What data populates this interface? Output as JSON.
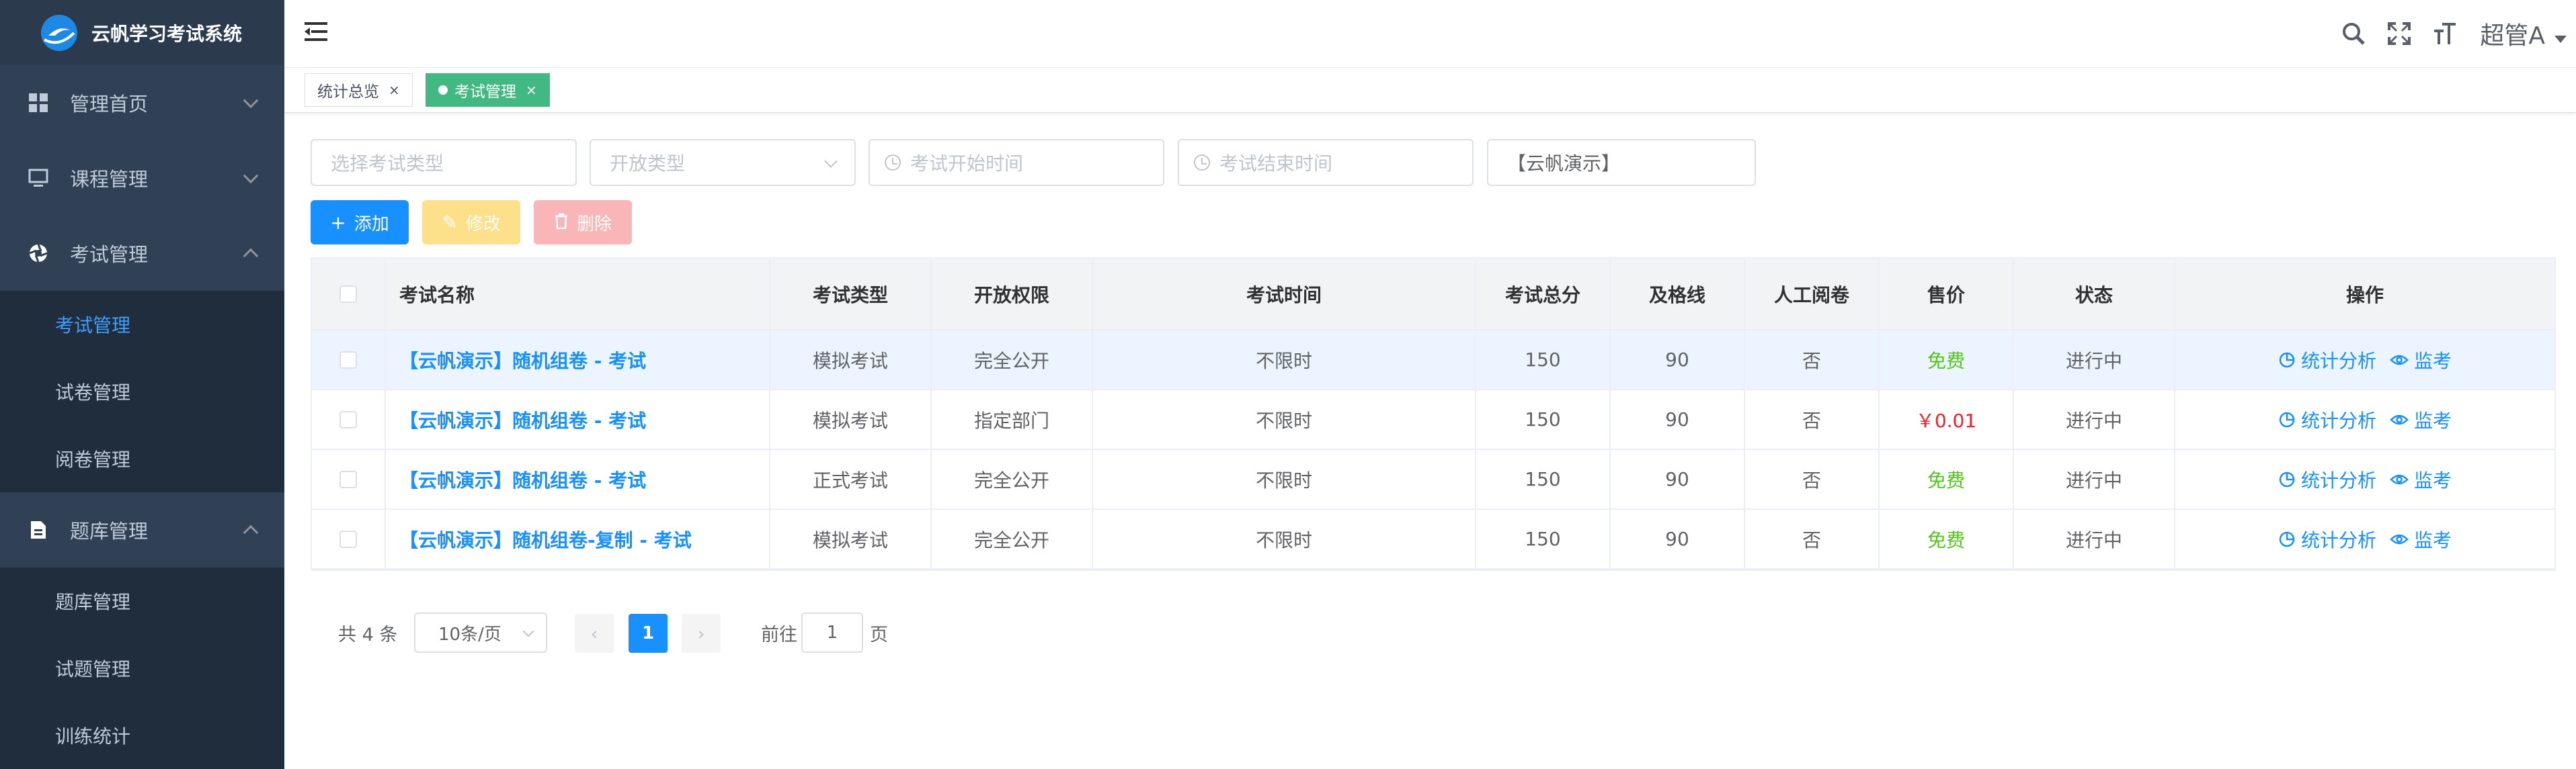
{
  "app": {
    "title": "云帆学习考试系统"
  },
  "sidebar": {
    "items": [
      {
        "label": "管理首页",
        "icon": "dashboard-icon",
        "expanded": false
      },
      {
        "label": "课程管理",
        "icon": "monitor-icon",
        "expanded": false
      },
      {
        "label": "考试管理",
        "icon": "aperture-icon",
        "expanded": true,
        "children": [
          {
            "label": "考试管理",
            "active": true
          },
          {
            "label": "试卷管理"
          },
          {
            "label": "阅卷管理"
          }
        ]
      },
      {
        "label": "题库管理",
        "icon": "document-icon",
        "expanded": true,
        "children": [
          {
            "label": "题库管理"
          },
          {
            "label": "试题管理"
          },
          {
            "label": "训练统计"
          }
        ]
      }
    ]
  },
  "header": {
    "user": "超管A"
  },
  "tabs": [
    {
      "label": "统计总览",
      "active": false
    },
    {
      "label": "考试管理",
      "active": true
    }
  ],
  "filters": {
    "exam_type_placeholder": "选择考试类型",
    "open_type_placeholder": "开放类型",
    "start_time_placeholder": "考试开始时间",
    "end_time_placeholder": "考试结束时间",
    "keyword_value": "【云帆演示】"
  },
  "toolbar": {
    "add": "添加",
    "edit": "修改",
    "delete": "删除"
  },
  "table": {
    "columns": [
      "考试名称",
      "考试类型",
      "开放权限",
      "考试时间",
      "考试总分",
      "及格线",
      "人工阅卷",
      "售价",
      "状态",
      "操作"
    ],
    "rows": [
      {
        "name": "【云帆演示】随机组卷 - 考试",
        "type": "模拟考试",
        "access": "完全公开",
        "time": "不限时",
        "total": "150",
        "pass": "90",
        "manual": "否",
        "price": "免费",
        "status": "进行中"
      },
      {
        "name": "【云帆演示】随机组卷 - 考试",
        "type": "模拟考试",
        "access": "指定部门",
        "time": "不限时",
        "total": "150",
        "pass": "90",
        "manual": "否",
        "price": "￥0.01",
        "status": "进行中"
      },
      {
        "name": "【云帆演示】随机组卷 - 考试",
        "type": "正式考试",
        "access": "完全公开",
        "time": "不限时",
        "total": "150",
        "pass": "90",
        "manual": "否",
        "price": "免费",
        "status": "进行中"
      },
      {
        "name": "【云帆演示】随机组卷-复制 - 考试",
        "type": "模拟考试",
        "access": "完全公开",
        "time": "不限时",
        "total": "150",
        "pass": "90",
        "manual": "否",
        "price": "免费",
        "status": "进行中"
      }
    ],
    "actions": {
      "stats": "统计分析",
      "monitor": "监考"
    }
  },
  "pagination": {
    "total": "共 4 条",
    "page_size": "10条/页",
    "current": "1",
    "goto_prefix": "前往",
    "goto_value": "1",
    "goto_suffix": "页"
  },
  "colors": {
    "primary": "#1890ff",
    "sidebar_bg": "#1f2d3d",
    "menu_bg": "#304156",
    "active_tag": "#42b983",
    "free": "#52c41a",
    "paid": "#f5222d"
  }
}
